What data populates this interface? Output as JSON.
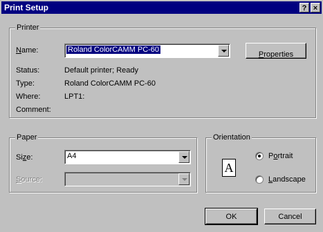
{
  "window": {
    "title": "Print Setup",
    "help_glyph": "?",
    "close_glyph": "×"
  },
  "printer": {
    "legend": "Printer",
    "name_label_pre": "",
    "name_label_ul": "N",
    "name_label_post": "ame:",
    "name_value": "Roland ColorCAMM PC-60",
    "properties_ul": "P",
    "properties_rest": "roperties",
    "status_label": "Status:",
    "status_value": "Default printer; Ready",
    "type_label": "Type:",
    "type_value": "Roland ColorCAMM PC-60",
    "where_label": "Where:",
    "where_value": "LPT1:",
    "comment_label": "Comment:"
  },
  "paper": {
    "legend": "Paper",
    "size_label_pre": "Si",
    "size_label_ul": "z",
    "size_label_post": "e:",
    "size_value": "A4",
    "source_label_ul": "S",
    "source_label_post": "ource:",
    "source_value": ""
  },
  "orientation": {
    "legend": "Orientation",
    "icon_glyph": "A",
    "portrait_ul": "o",
    "portrait_pre": "P",
    "portrait_post": "rtrait",
    "landscape_ul": "L",
    "landscape_post": "andscape",
    "selected": "portrait"
  },
  "buttons": {
    "ok": "OK",
    "cancel": "Cancel"
  }
}
